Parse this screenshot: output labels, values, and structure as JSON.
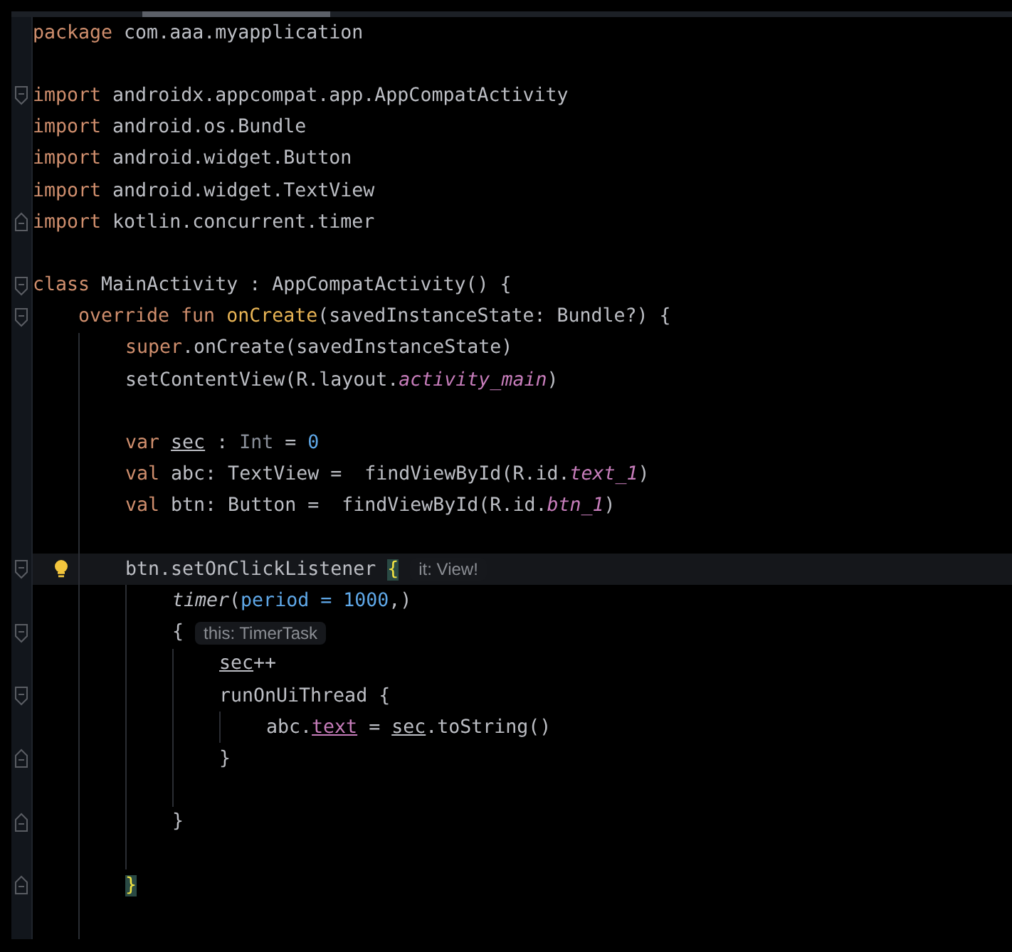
{
  "lines": [
    {
      "current": false,
      "tokens": [
        {
          "kind": "kw",
          "text": "package "
        },
        {
          "kind": "plain",
          "text": "com.aaa.myapplication"
        }
      ]
    },
    {
      "current": false
    },
    {
      "current": false,
      "fold_start": true,
      "tokens": [
        {
          "kind": "kw",
          "text": "import "
        },
        {
          "kind": "plain",
          "text": "androidx.appcompat.app.AppCompatActivity"
        }
      ]
    },
    {
      "current": false,
      "tokens": [
        {
          "kind": "kw",
          "text": "import "
        },
        {
          "kind": "plain",
          "text": "android.os.Bundle"
        }
      ]
    },
    {
      "current": false,
      "tokens": [
        {
          "kind": "kw",
          "text": "import "
        },
        {
          "kind": "plain",
          "text": "android.widget.Button"
        }
      ]
    },
    {
      "current": false,
      "tokens": [
        {
          "kind": "kw",
          "text": "import "
        },
        {
          "kind": "plain",
          "text": "android.widget.TextView"
        }
      ]
    },
    {
      "current": false,
      "fold_end": true,
      "tokens": [
        {
          "kind": "kw",
          "text": "import "
        },
        {
          "kind": "plain",
          "text": "kotlin.concurrent.timer"
        }
      ]
    },
    {
      "current": false
    },
    {
      "current": false,
      "fold_start": true,
      "tokens": [
        {
          "kind": "kw",
          "text": "class "
        },
        {
          "kind": "plain",
          "text": "MainActivity : AppCompatActivity() {"
        }
      ]
    },
    {
      "current": false,
      "fold_start": true,
      "tokens": [
        {
          "kind": "kw",
          "text": "    override fun "
        },
        {
          "kind": "fn",
          "text": "onCreate"
        },
        {
          "kind": "plain",
          "text": "(savedInstanceState: Bundle?) {"
        }
      ]
    },
    {
      "current": false,
      "tokens": [
        {
          "kind": "kw",
          "text": "        super"
        },
        {
          "kind": "plain",
          "text": ".onCreate(savedInstanceState)"
        }
      ]
    },
    {
      "current": false,
      "tokens": [
        {
          "kind": "plain",
          "text": "        setContentView(R.layout."
        },
        {
          "kind": "static",
          "text": "activity_main"
        },
        {
          "kind": "plain",
          "text": ")"
        }
      ]
    },
    {
      "current": false
    },
    {
      "current": false,
      "tokens": [
        {
          "kind": "kw",
          "text": "        var "
        },
        {
          "kind": "mutable",
          "text": "sec"
        },
        {
          "kind": "plain",
          "text": " : "
        },
        {
          "kind": "type",
          "text": "Int"
        },
        {
          "kind": "plain",
          "text": " = "
        },
        {
          "kind": "num",
          "text": "0"
        }
      ]
    },
    {
      "current": false,
      "tokens": [
        {
          "kind": "kw",
          "text": "        val "
        },
        {
          "kind": "plain",
          "text": "abc: TextView =  findViewById(R.id."
        },
        {
          "kind": "static",
          "text": "text_1"
        },
        {
          "kind": "plain",
          "text": ")"
        }
      ]
    },
    {
      "current": false,
      "tokens": [
        {
          "kind": "kw",
          "text": "        val "
        },
        {
          "kind": "plain",
          "text": "btn: Button =  findViewById(R.id."
        },
        {
          "kind": "static",
          "text": "btn_1"
        },
        {
          "kind": "plain",
          "text": ")"
        }
      ]
    },
    {
      "current": false
    },
    {
      "current": true,
      "fold_start": true,
      "tokens": [
        {
          "kind": "plain",
          "text": "        btn.setOnClickListener "
        },
        {
          "kind": "match",
          "text": "{"
        }
      ],
      "hint": "it: View!"
    },
    {
      "current": false,
      "tokens": [
        {
          "kind": "call",
          "text": "            timer"
        },
        {
          "kind": "plain",
          "text": "("
        },
        {
          "kind": "named",
          "text": "period = 1000"
        },
        {
          "kind": "plain",
          "text": ",)"
        }
      ]
    },
    {
      "current": false,
      "fold_start": true,
      "tokens": [
        {
          "kind": "plain",
          "text": "            {"
        }
      ],
      "hint": "this: TimerTask"
    },
    {
      "current": false,
      "tokens": [
        {
          "kind": "mutable",
          "text": "                sec"
        },
        {
          "kind": "plain",
          "text": "++"
        }
      ]
    },
    {
      "current": false,
      "fold_start": true,
      "tokens": [
        {
          "kind": "plain",
          "text": "                runOnUiThread {"
        }
      ]
    },
    {
      "current": false,
      "tokens": [
        {
          "kind": "plain",
          "text": "                    abc."
        },
        {
          "kind": "prop",
          "text": "text"
        },
        {
          "kind": "plain",
          "text": " = "
        },
        {
          "kind": "mutable",
          "text": "sec"
        },
        {
          "kind": "plain",
          "text": ".toString()"
        }
      ]
    },
    {
      "current": false,
      "fold_end": true,
      "tokens": [
        {
          "kind": "plain",
          "text": "                }"
        }
      ]
    },
    {
      "current": false
    },
    {
      "current": false,
      "fold_end": true,
      "tokens": [
        {
          "kind": "plain",
          "text": "            }"
        }
      ]
    },
    {
      "current": false
    },
    {
      "current": false,
      "fold_end": true,
      "tokens": [
        {
          "kind": "match",
          "text": "        }"
        }
      ]
    }
  ]
}
